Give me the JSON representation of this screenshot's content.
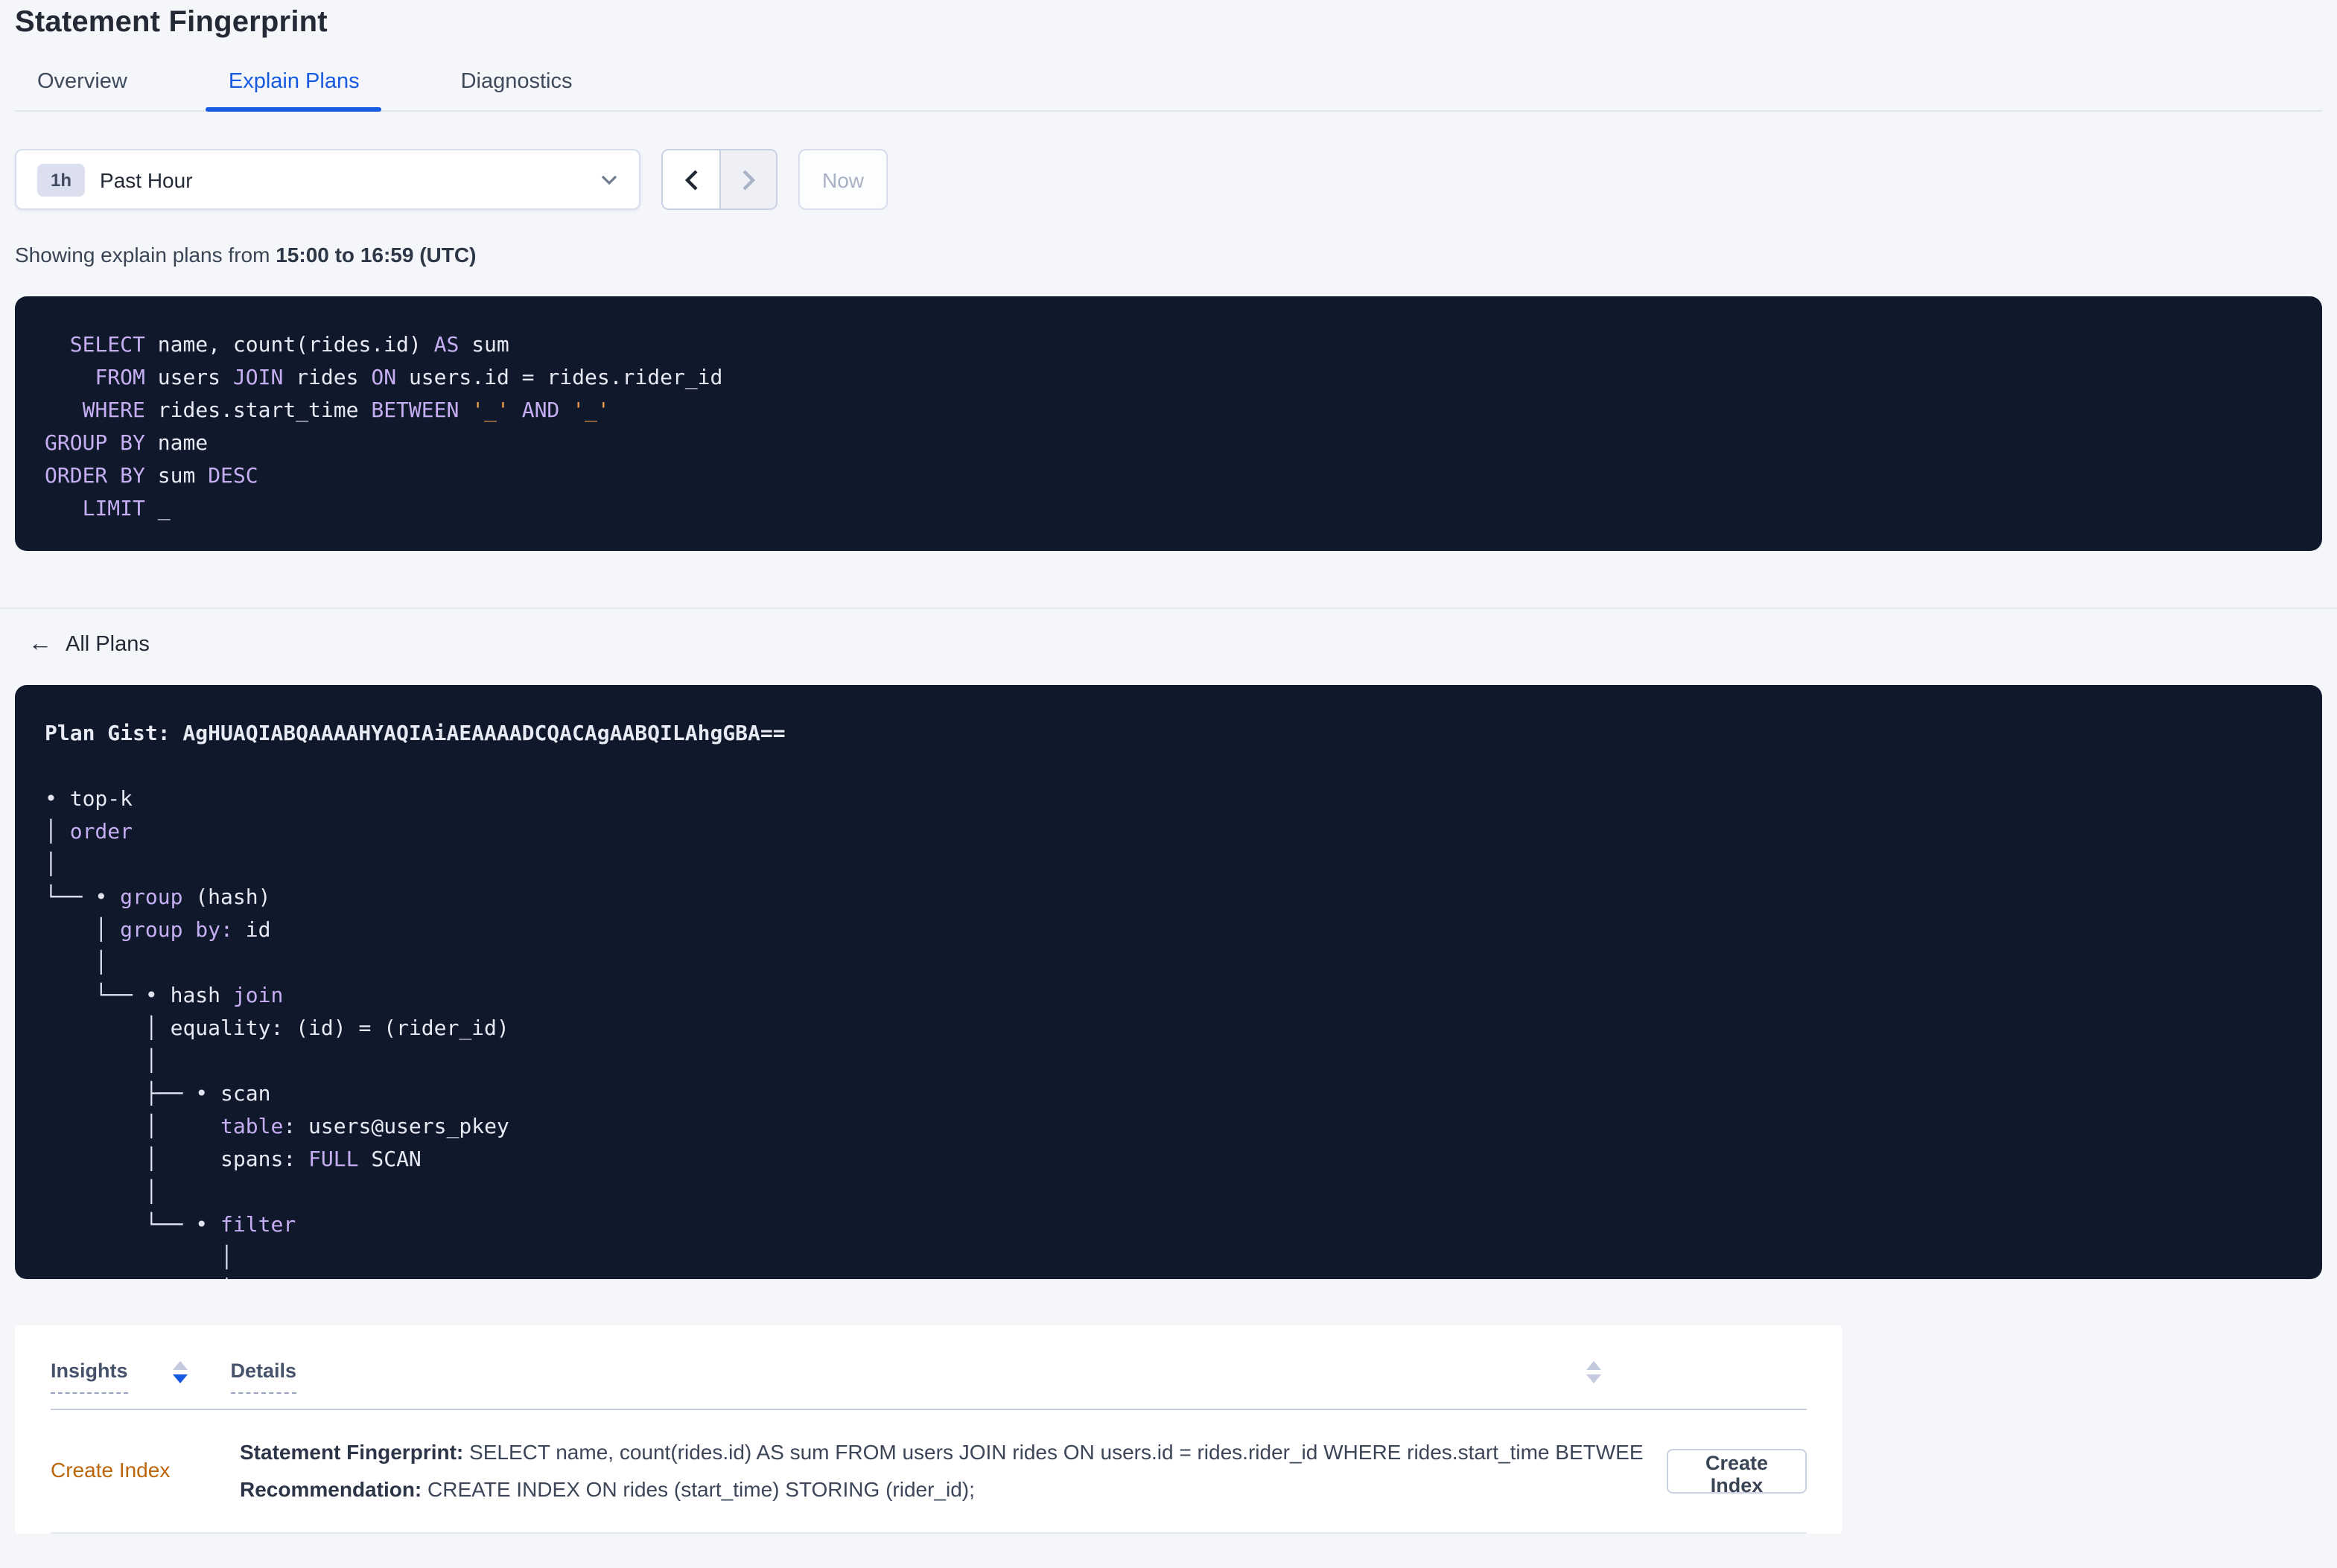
{
  "page": {
    "title": "Statement Fingerprint"
  },
  "tabs": [
    {
      "label": "Overview",
      "active": false
    },
    {
      "label": "Explain Plans",
      "active": true
    },
    {
      "label": "Diagnostics",
      "active": false
    }
  ],
  "toolbar": {
    "range_badge": "1h",
    "range_label": "Past Hour",
    "now_label": "Now"
  },
  "showing": {
    "prefix": "Showing explain plans from ",
    "range": "15:00 to 16:59 (UTC)"
  },
  "sql": {
    "lines": [
      [
        {
          "t": "  ",
          "s": "i"
        },
        {
          "t": "SELECT",
          "s": "k"
        },
        {
          "t": " name, count(rides.id) ",
          "s": "i"
        },
        {
          "t": "AS",
          "s": "k"
        },
        {
          "t": " sum",
          "s": "i"
        }
      ],
      [
        {
          "t": "    ",
          "s": "i"
        },
        {
          "t": "FROM",
          "s": "k"
        },
        {
          "t": " users ",
          "s": "i"
        },
        {
          "t": "JOIN",
          "s": "k"
        },
        {
          "t": " rides ",
          "s": "i"
        },
        {
          "t": "ON",
          "s": "k"
        },
        {
          "t": " users.id = rides.rider_id",
          "s": "i"
        }
      ],
      [
        {
          "t": "   ",
          "s": "i"
        },
        {
          "t": "WHERE",
          "s": "k"
        },
        {
          "t": " rides.start_time ",
          "s": "i"
        },
        {
          "t": "BETWEEN",
          "s": "k"
        },
        {
          "t": " ",
          "s": "i"
        },
        {
          "t": "'_'",
          "s": "l"
        },
        {
          "t": " ",
          "s": "i"
        },
        {
          "t": "AND",
          "s": "k"
        },
        {
          "t": " ",
          "s": "i"
        },
        {
          "t": "'_'",
          "s": "l"
        }
      ],
      [
        {
          "t": "GROUP BY",
          "s": "k"
        },
        {
          "t": " name",
          "s": "i"
        }
      ],
      [
        {
          "t": "ORDER BY",
          "s": "k"
        },
        {
          "t": " sum ",
          "s": "i"
        },
        {
          "t": "DESC",
          "s": "k"
        }
      ],
      [
        {
          "t": "   ",
          "s": "i"
        },
        {
          "t": "LIMIT",
          "s": "k"
        },
        {
          "t": " _",
          "s": "i"
        }
      ]
    ]
  },
  "nav": {
    "back_arrow": "←",
    "all_plans": "All Plans"
  },
  "plan": {
    "gist_line": "Plan Gist: AgHUAQIABQAAAAHYAQIAiAEAAAADCQACAgAABQILAhgGBA==",
    "tree": [
      [
        {
          "t": "• ",
          "s": "t"
        },
        {
          "t": "top-k",
          "s": "i"
        }
      ],
      [
        {
          "t": "│ ",
          "s": "t"
        },
        {
          "t": "order",
          "s": "k"
        }
      ],
      [
        {
          "t": "│",
          "s": "t"
        }
      ],
      [
        {
          "t": "└── • ",
          "s": "t"
        },
        {
          "t": "group",
          "s": "k"
        },
        {
          "t": " (hash)",
          "s": "i"
        }
      ],
      [
        {
          "t": "    │ ",
          "s": "t"
        },
        {
          "t": "group by:",
          "s": "k"
        },
        {
          "t": " id",
          "s": "i"
        }
      ],
      [
        {
          "t": "    │",
          "s": "t"
        }
      ],
      [
        {
          "t": "    └── • ",
          "s": "t"
        },
        {
          "t": "hash ",
          "s": "i"
        },
        {
          "t": "join",
          "s": "k"
        }
      ],
      [
        {
          "t": "        │ ",
          "s": "t"
        },
        {
          "t": "equality: (id) = (rider_id)",
          "s": "i"
        }
      ],
      [
        {
          "t": "        │",
          "s": "t"
        }
      ],
      [
        {
          "t": "        ├── • ",
          "s": "t"
        },
        {
          "t": "scan",
          "s": "i"
        }
      ],
      [
        {
          "t": "        │     ",
          "s": "t"
        },
        {
          "t": "table",
          "s": "k"
        },
        {
          "t": ": users@users_pkey",
          "s": "i"
        }
      ],
      [
        {
          "t": "        │     ",
          "s": "t"
        },
        {
          "t": "spans: ",
          "s": "i"
        },
        {
          "t": "FULL",
          "s": "k"
        },
        {
          "t": " SCAN",
          "s": "i"
        }
      ],
      [
        {
          "t": "        │",
          "s": "t"
        }
      ],
      [
        {
          "t": "        └── • ",
          "s": "t"
        },
        {
          "t": "filter",
          "s": "k"
        }
      ],
      [
        {
          "t": "              │",
          "s": "t"
        }
      ],
      [
        {
          "t": "              │",
          "s": "t"
        }
      ]
    ]
  },
  "insights_table": {
    "columns": [
      "Insights",
      "Details"
    ],
    "sort": {
      "insights": "desc",
      "actions": "none"
    },
    "rows": [
      {
        "insight": "Create Index",
        "fingerprint_label": "Statement Fingerprint:",
        "fingerprint": " SELECT name, count(rides.id) AS sum FROM users JOIN rides ON users.id = rides.rider_id WHERE rides.start_time BETWEEN '_…",
        "recommendation_label": "Recommendation:",
        "recommendation": " CREATE INDEX ON rides (start_time) STORING (rider_id);",
        "action": "Create Index"
      }
    ]
  },
  "colors": {
    "accent_blue": "#1659e2",
    "insight_orange": "#bd650b",
    "code_background": "#10182c",
    "code_keyword": "#c5aef2",
    "code_literal": "#ed9c49",
    "code_text": "#e7e9f3",
    "page_background": "#f4f6fa"
  }
}
